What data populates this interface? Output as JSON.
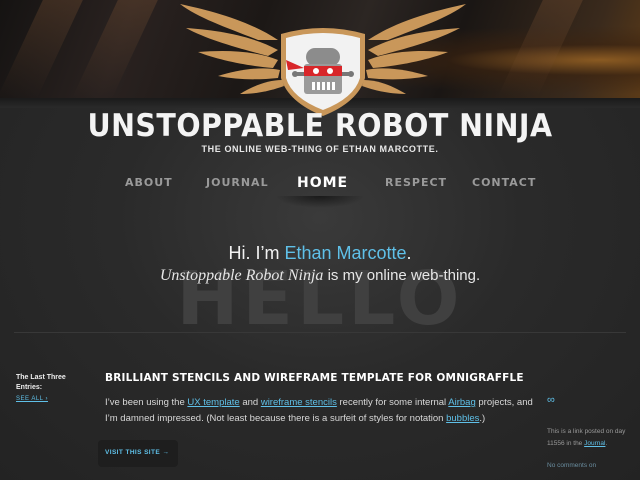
{
  "site": {
    "title": "UNSTOPPABLE ROBOT NINJA",
    "tagline": "THE ONLINE WEB-THING OF ETHAN MARCOTTE."
  },
  "nav": {
    "items": [
      {
        "label": "ABOUT"
      },
      {
        "label": "JOURNAL"
      },
      {
        "label": "HOME",
        "current": true
      },
      {
        "label": "RESPECT"
      },
      {
        "label": "CONTACT"
      }
    ]
  },
  "intro": {
    "greeting": "Hi. I’m",
    "name": "Ethan Marcotte",
    "period": ".",
    "site_name": "Unstoppable Robot Ninja",
    "rest": " is my online web-thing.",
    "hello_bg": "HELLO"
  },
  "sidebar": {
    "label": "The Last Three Entries:",
    "see_all": "SEE ALL ›"
  },
  "post": {
    "title": "BRILLIANT STENCILS AND WIREFRAME TEMPLATE FOR OMNIGRAFFLE",
    "t1": "I’ve been using the ",
    "link1": "UX template",
    "t2": " and ",
    "link2": "wireframe stencils",
    "t3": " recently for some internal ",
    "link3": "Airbag",
    "t4": " projects, and I’m damned impressed. (Not least because there is a surfeit of styles for notation ",
    "link4": "bubbles",
    "t5": ".)",
    "visit_label": "VISIT THIS SITE →"
  },
  "meta": {
    "symbol": "∞",
    "posted_text": "This is a link posted on day 11556 in the ",
    "category": "Journal",
    "period": ".",
    "comments": "No comments on"
  },
  "colors": {
    "accent": "#5fc0e8",
    "background": "#262626",
    "logo_gold": "#c9975a",
    "robot_red": "#d8262a"
  }
}
